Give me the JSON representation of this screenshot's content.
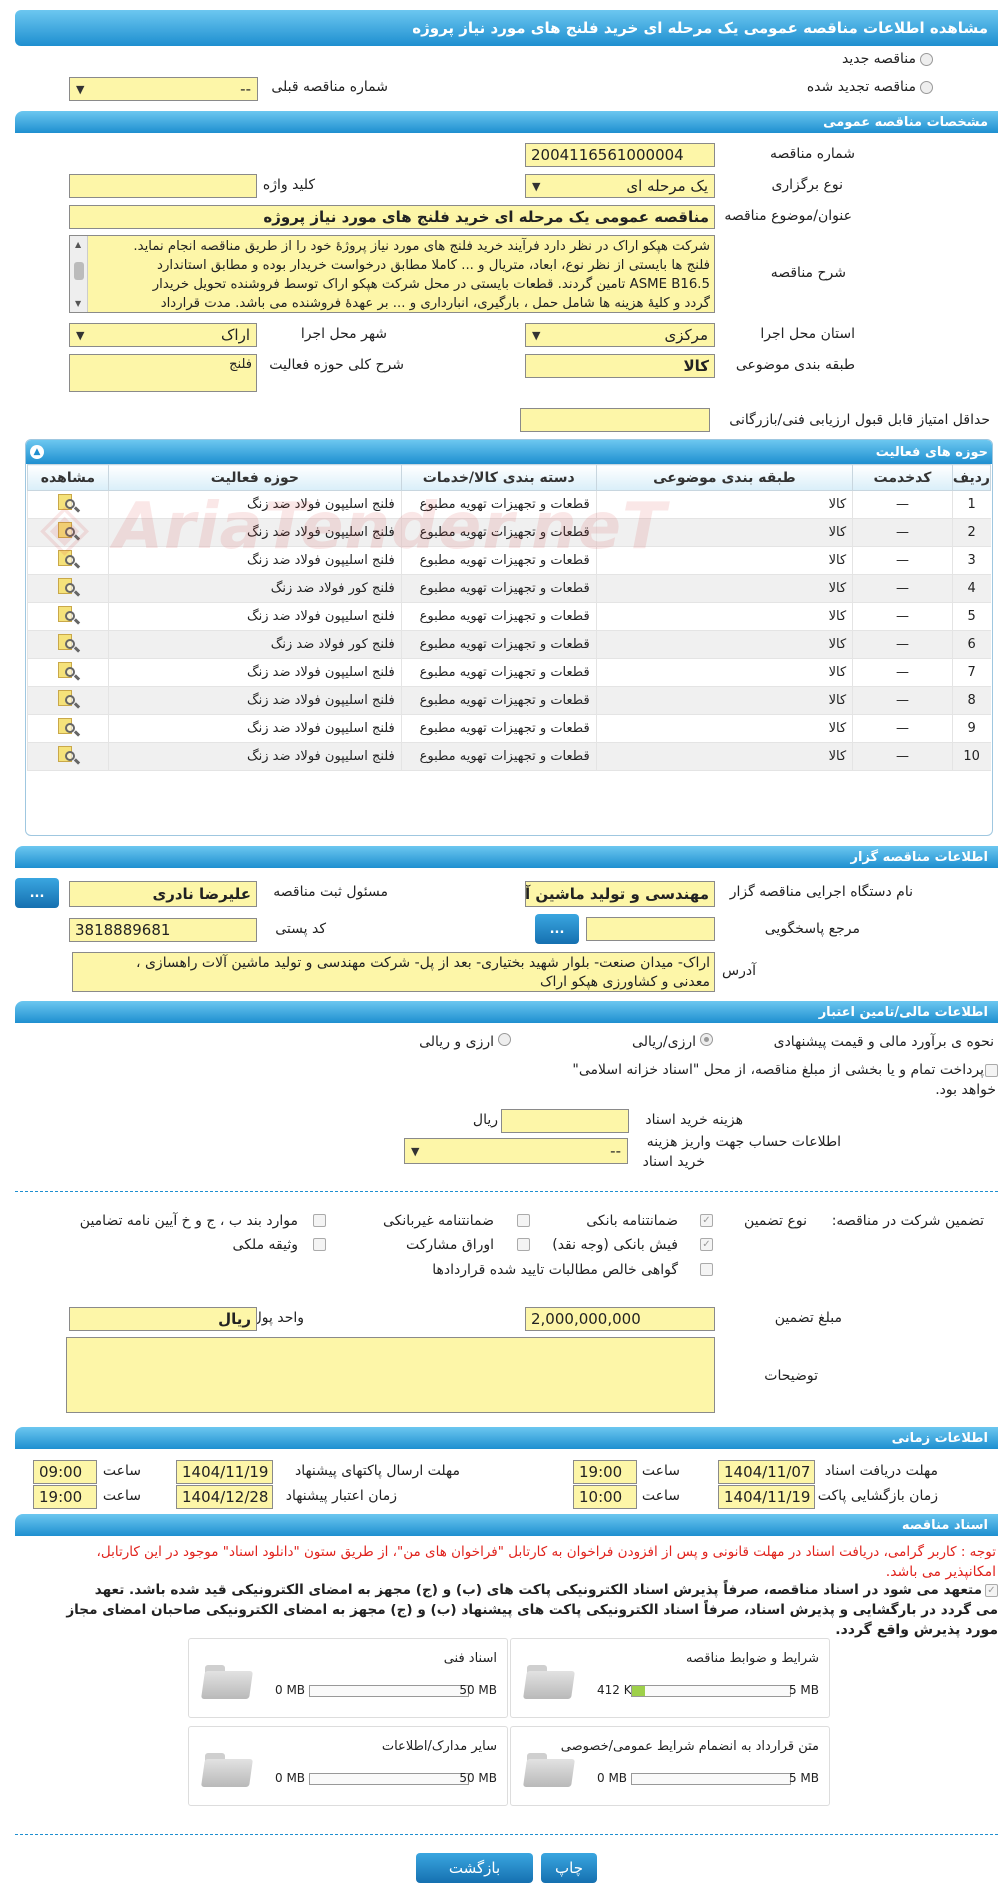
{
  "page_title": "مشاهده اطلاعات مناقصه عمومی یک مرحله ای خرید فلنج های مورد نیاز پروژه",
  "top": {
    "radio_new": "مناقصه جدید",
    "radio_renewed": "مناقصه تجدید شده",
    "prev_number_label": "شماره مناقصه قبلی",
    "prev_number_value": "--"
  },
  "general": {
    "section_title": "مشخصات مناقصه عمومی",
    "number_label": "شماره مناقصه",
    "number_value": "2004116561000004",
    "type_label": "نوع برگزاری",
    "type_value": "یک مرحله ای",
    "keyword_label": "کلید واژه",
    "keyword_value": "",
    "subject_label": "عنوان/موضوع مناقصه",
    "subject_value": "مناقصه عمومی یک مرحله ای خرید فلنج های مورد نیاز پروژه",
    "desc_label": "شرح مناقصه",
    "desc_lines": [
      "شرکت هپکو اراک در نظر دارد فرآیند خرید فلنج های مورد نیاز پروژهٔ خود را از طریق مناقصه انجام نماید.",
      "فلنج ها بایستی از نظر نوع، ابعاد، متریال و ... کاملا مطابق درخواست خریدار بوده و مطابق استاندارد",
      "ASME B16.5 تامین گردند. قطعات بایستی در محل شرکت هپکو اراک توسط فروشنده تحویل خریدار",
      "گردد و کلیهٔ هزینه ها شامل حمل ، بارگیری، انبارداری و ... بر عهدهٔ فروشنده می باشد. مدت قرارداد"
    ],
    "province_label": "استان محل اجرا",
    "province_value": "مرکزی",
    "city_label": "شهر محل اجرا",
    "city_value": "اراک",
    "category_label": "طبقه بندی موضوعی",
    "category_value": "کالا",
    "activity_desc_label": "شرح کلی حوزه فعالیت",
    "activity_desc_value": "فلنج",
    "min_score_label": "حداقل امتیاز قابل قبول ارزیابی فنی/بازرگانی",
    "min_score_value": ""
  },
  "activities": {
    "section_title": "حوزه های فعالیت",
    "headers": [
      "ردیف",
      "کدخدمت",
      "طبقه بندی موضوعی",
      "دسته بندی کالا/خدمات",
      "حوزه فعالیت",
      "مشاهده"
    ],
    "rows": [
      [
        "1",
        "—",
        "کالا",
        "قطعات و تجهیزات تهویه مطبوع",
        "فلنج اسلیپون فولاد ضد زنگ"
      ],
      [
        "2",
        "—",
        "کالا",
        "قطعات و تجهیزات تهویه مطبوع",
        "فلنج اسلیپون فولاد ضد زنگ"
      ],
      [
        "3",
        "—",
        "کالا",
        "قطعات و تجهیزات تهویه مطبوع",
        "فلنج اسلیپون فولاد ضد زنگ"
      ],
      [
        "4",
        "—",
        "کالا",
        "قطعات و تجهیزات تهویه مطبوع",
        "فلنج کور فولاد ضد زنگ"
      ],
      [
        "5",
        "—",
        "کالا",
        "قطعات و تجهیزات تهویه مطبوع",
        "فلنج اسلیپون فولاد ضد زنگ"
      ],
      [
        "6",
        "—",
        "کالا",
        "قطعات و تجهیزات تهویه مطبوع",
        "فلنج کور فولاد ضد زنگ"
      ],
      [
        "7",
        "—",
        "کالا",
        "قطعات و تجهیزات تهویه مطبوع",
        "فلنج اسلیپون فولاد ضد زنگ"
      ],
      [
        "8",
        "—",
        "کالا",
        "قطعات و تجهیزات تهویه مطبوع",
        "فلنج اسلیپون فولاد ضد زنگ"
      ],
      [
        "9",
        "—",
        "کالا",
        "قطعات و تجهیزات تهویه مطبوع",
        "فلنج اسلیپون فولاد ضد زنگ"
      ],
      [
        "10",
        "—",
        "کالا",
        "قطعات و تجهیزات تهویه مطبوع",
        "فلنج اسلیپون فولاد ضد زنگ"
      ]
    ]
  },
  "organizer": {
    "section_title": "اطلاعات مناقصه گزار",
    "device_label": "نام دستگاه اجرایی مناقصه گزار",
    "device_value": "مهندسی و تولید ماشین آلا",
    "registrar_label": "مسئول ثبت مناقصه",
    "registrar_value": "علیرضا نادری",
    "ref_label": "مرجع پاسخگویی",
    "ref_value": "",
    "postal_label": "کد پستی",
    "postal_value": "3818889681",
    "address_label": "آدرس",
    "address_lines": [
      "اراک- میدان صنعت- بلوار شهید بختیاری- بعد از پل- شرکت مهندسی و تولید ماشین آلات راهسازی ،",
      "معدنی و کشاورزی هپکو اراک"
    ],
    "dots": "..."
  },
  "finance": {
    "section_title": "اطلاعات مالی/تامین اعتبار",
    "estimate_label": "نحوه ی برآورد مالی و قیمت پیشنهادی",
    "opt1": "ارزی/ریالی",
    "opt2": "ارزی و ریالی",
    "treasury_line1": "پرداخت تمام و یا بخشی از مبلغ مناقصه، از محل \"اسناد خزانه اسلامی\"",
    "treasury_line2": "خواهد بود.",
    "doc_cost_label": "هزینه خرید اسناد",
    "doc_cost_value": "",
    "doc_cost_unit": "ریال",
    "account_label_1": "اطلاعات حساب جهت واریز هزینه",
    "account_label_2": "خرید اسناد",
    "account_value": "--"
  },
  "guarantee": {
    "label": "تضمین شرکت در مناقصه:",
    "type_label": "نوع تضمین",
    "items": [
      {
        "label": "ضمانتنامه بانکی",
        "checked": true
      },
      {
        "label": "ضمانتنامه غیربانکی",
        "checked": false
      },
      {
        "label": "موارد بند ب ، ج و خ آیین نامه تضامین",
        "checked": false
      },
      {
        "label": "فیش بانکی (وجه نقد)",
        "checked": true
      },
      {
        "label": "اوراق مشارکت",
        "checked": false
      },
      {
        "label": "وثیقه ملکی",
        "checked": false
      },
      {
        "label": "گواهی خالص مطالبات تایید شده قراردادها",
        "checked": false
      }
    ],
    "amount_label": "مبلغ تضمین",
    "amount_value": "2,000,000,000",
    "currency_label": "واحد پول",
    "currency_value": "ریال",
    "notes_label": "توضیحات",
    "notes_value": ""
  },
  "timing": {
    "section_title": "اطلاعات زمانی",
    "receive_label": "مهلت دریافت اسناد",
    "receive_date": "1404/11/07",
    "receive_time": "19:00",
    "send_label": "مهلت ارسال پاکتهای پیشنهاد",
    "send_date": "1404/11/19",
    "send_time": "09:00",
    "open_label": "زمان بازگشایی پاکت ها",
    "open_date": "1404/11/19",
    "open_time": "10:00",
    "validity_label": "زمان اعتبار پیشنهاد",
    "validity_date": "1404/12/28",
    "validity_time": "19:00",
    "time_label": "ساعت"
  },
  "documents": {
    "section_title": "اسناد مناقصه",
    "note_red_1": "توجه : کاربر گرامی، دریافت اسناد در مهلت قانونی و پس از افزودن فراخوان به کارتابل \"فراخوان های من\"، از طریق ستون \"دانلود اسناد\" موجود در این کارتابل،",
    "note_red_2": "امکانپذیر می باشد.",
    "commit_1": "متعهد می شود در اسناد مناقصه، صرفاً پذیرش اسناد الکترونیکی پاکت های (ب) و (ج) مجهز به امضای الکترونیکی قید شده باشد. تعهد",
    "commit_2": "می گردد در بارگشایی و پذیرش اسناد، صرفاً اسناد الکترونیکی پاکت های پیشنهاد (ب) و (ج) مجهز به امضای الکترونیکی صاحبان امضای مجاز",
    "commit_3": "مورد پذیرش واقع گردد.",
    "boxes": [
      {
        "title": "شرایط و ضوابط مناقصه",
        "min": "412 KB",
        "max": "5 MB",
        "fill": 0.08
      },
      {
        "title": "اسناد فنی",
        "min": "0 MB",
        "max": "50 MB",
        "fill": 0
      },
      {
        "title": "متن قرارداد به انضمام شرایط عمومی/خصوصی",
        "min": "0 MB",
        "max": "5 MB",
        "fill": 0
      },
      {
        "title": "سایر مدارک/اطلاعات",
        "min": "0 MB",
        "max": "50 MB",
        "fill": 0
      }
    ]
  },
  "buttons": {
    "print": "چاپ",
    "back": "بازگشت"
  },
  "colors": {
    "accent": "#1e8fd0",
    "field_bg": "#fdf6a8",
    "red_note": "#e0231d"
  }
}
